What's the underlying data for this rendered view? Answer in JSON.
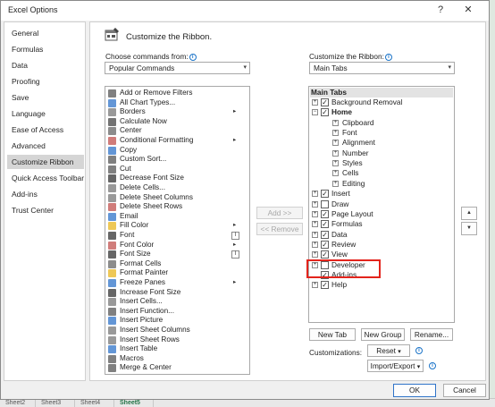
{
  "window": {
    "title": "Excel Options",
    "help_glyph": "?",
    "close_glyph": "✕"
  },
  "nav": {
    "items": [
      {
        "label": "General",
        "selected": false
      },
      {
        "label": "Formulas",
        "selected": false
      },
      {
        "label": "Data",
        "selected": false
      },
      {
        "label": "Proofing",
        "selected": false
      },
      {
        "label": "Save",
        "selected": false
      },
      {
        "label": "Language",
        "selected": false
      },
      {
        "label": "Ease of Access",
        "selected": false
      },
      {
        "label": "Advanced",
        "selected": false
      },
      {
        "label": "Customize Ribbon",
        "selected": true
      },
      {
        "label": "Quick Access Toolbar",
        "selected": false
      },
      {
        "label": "Add-ins",
        "selected": false
      },
      {
        "label": "Trust Center",
        "selected": false
      }
    ]
  },
  "header": {
    "title": "Customize the Ribbon.",
    "icon": "customize-ribbon-icon"
  },
  "choose": {
    "label": "Choose commands from:",
    "value": "Popular Commands",
    "info_glyph": "i"
  },
  "customize": {
    "label": "Customize the Ribbon:",
    "value": "Main Tabs",
    "info_glyph": "i"
  },
  "commands": [
    {
      "label": "Add or Remove Filters",
      "icon": "filter-icon",
      "submenu": ""
    },
    {
      "label": "All Chart Types...",
      "icon": "chart-icon",
      "submenu": ""
    },
    {
      "label": "Borders",
      "icon": "borders-icon",
      "submenu": "▸"
    },
    {
      "label": "Calculate Now",
      "icon": "calculator-icon",
      "submenu": ""
    },
    {
      "label": "Center",
      "icon": "align-center-icon",
      "submenu": ""
    },
    {
      "label": "Conditional Formatting",
      "icon": "conditional-format-icon",
      "submenu": "▸"
    },
    {
      "label": "Copy",
      "icon": "copy-icon",
      "submenu": ""
    },
    {
      "label": "Custom Sort...",
      "icon": "sort-icon",
      "submenu": ""
    },
    {
      "label": "Cut",
      "icon": "scissors-icon",
      "submenu": ""
    },
    {
      "label": "Decrease Font Size",
      "icon": "decrease-font-icon",
      "submenu": ""
    },
    {
      "label": "Delete Cells...",
      "icon": "delete-cells-icon",
      "submenu": ""
    },
    {
      "label": "Delete Sheet Columns",
      "icon": "delete-columns-icon",
      "submenu": ""
    },
    {
      "label": "Delete Sheet Rows",
      "icon": "delete-rows-icon",
      "submenu": ""
    },
    {
      "label": "Email",
      "icon": "email-icon",
      "submenu": ""
    },
    {
      "label": "Fill Color",
      "icon": "fill-color-icon",
      "submenu": "▸"
    },
    {
      "label": "Font",
      "icon": "font-icon",
      "submenu": "",
      "mini": "I"
    },
    {
      "label": "Font Color",
      "icon": "font-color-icon",
      "submenu": "▸"
    },
    {
      "label": "Font Size",
      "icon": "font-size-icon",
      "submenu": "",
      "mini": "I"
    },
    {
      "label": "Format Cells",
      "icon": "format-cells-icon",
      "submenu": ""
    },
    {
      "label": "Format Painter",
      "icon": "format-painter-icon",
      "submenu": ""
    },
    {
      "label": "Freeze Panes",
      "icon": "freeze-panes-icon",
      "submenu": "▸"
    },
    {
      "label": "Increase Font Size",
      "icon": "increase-font-icon",
      "submenu": ""
    },
    {
      "label": "Insert Cells...",
      "icon": "insert-cells-icon",
      "submenu": ""
    },
    {
      "label": "Insert Function...",
      "icon": "function-icon",
      "submenu": ""
    },
    {
      "label": "Insert Picture",
      "icon": "picture-icon",
      "submenu": ""
    },
    {
      "label": "Insert Sheet Columns",
      "icon": "insert-columns-icon",
      "submenu": ""
    },
    {
      "label": "Insert Sheet Rows",
      "icon": "insert-rows-icon",
      "submenu": ""
    },
    {
      "label": "Insert Table",
      "icon": "table-icon",
      "submenu": ""
    },
    {
      "label": "Macros",
      "icon": "macros-icon",
      "submenu": ""
    },
    {
      "label": "Merge & Center",
      "icon": "merge-center-icon",
      "submenu": ""
    }
  ],
  "middle": {
    "add_label": "Add >>",
    "remove_label": "<< Remove"
  },
  "tree": {
    "header": "Main Tabs",
    "rows": [
      {
        "label": "Background Removal",
        "level": 0,
        "expander": "+",
        "checked": true
      },
      {
        "label": "Home",
        "level": 0,
        "expander": "−",
        "checked": true,
        "bold": true
      },
      {
        "label": "Clipboard",
        "level": 1,
        "expander": "+"
      },
      {
        "label": "Font",
        "level": 1,
        "expander": "+"
      },
      {
        "label": "Alignment",
        "level": 1,
        "expander": "+"
      },
      {
        "label": "Number",
        "level": 1,
        "expander": "+"
      },
      {
        "label": "Styles",
        "level": 1,
        "expander": "+"
      },
      {
        "label": "Cells",
        "level": 1,
        "expander": "+"
      },
      {
        "label": "Editing",
        "level": 1,
        "expander": "+"
      },
      {
        "label": "Insert",
        "level": 0,
        "expander": "+",
        "checked": true
      },
      {
        "label": "Draw",
        "level": 0,
        "expander": "+",
        "checked": false
      },
      {
        "label": "Page Layout",
        "level": 0,
        "expander": "+",
        "checked": true
      },
      {
        "label": "Formulas",
        "level": 0,
        "expander": "+",
        "checked": true
      },
      {
        "label": "Data",
        "level": 0,
        "expander": "+",
        "checked": true
      },
      {
        "label": "Review",
        "level": 0,
        "expander": "+",
        "checked": true
      },
      {
        "label": "View",
        "level": 0,
        "expander": "+",
        "checked": true
      },
      {
        "label": "Developer",
        "level": 0,
        "expander": "+",
        "checked": false
      },
      {
        "label": "Add-ins",
        "level": 0,
        "expander": "",
        "checked": true
      },
      {
        "label": "Help",
        "level": 0,
        "expander": "+",
        "checked": true
      }
    ]
  },
  "tree_buttons": {
    "new_tab": "New Tab",
    "new_group": "New Group",
    "rename": "Rename..."
  },
  "customizations": {
    "label": "Customizations:",
    "reset": "Reset",
    "import_export": "Import/Export",
    "dropdown_glyph": "▾"
  },
  "move": {
    "up_glyph": "▲",
    "down_glyph": "▼"
  },
  "footer": {
    "ok": "OK",
    "cancel": "Cancel"
  },
  "sheet_tabs": [
    "Sheet2",
    "Sheet3",
    "Sheet4",
    "Sheet5"
  ],
  "colors": {
    "accent": "#2f73c8",
    "highlight_box": "#e3241c",
    "selected_nav": "#d5d5d5"
  }
}
